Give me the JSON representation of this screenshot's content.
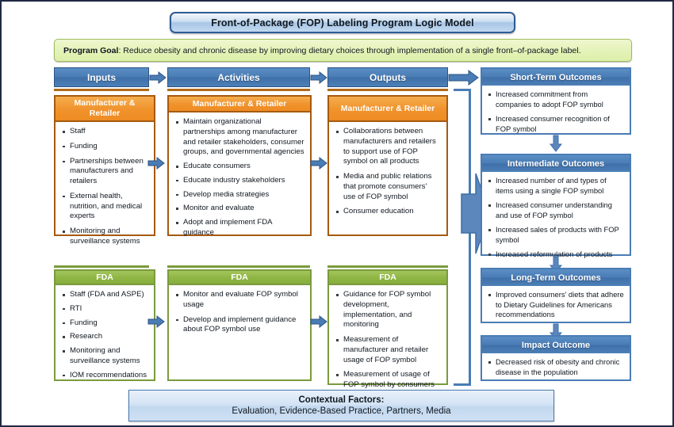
{
  "diagram": {
    "title": "Front-of-Package (FOP) Labeling Program Logic Model",
    "program_goal_label": "Program Goal",
    "program_goal_text": ": Reduce obesity and chronic disease by improving dietary choices through implementation of a single front–of-package label.",
    "colors": {
      "header_blue": "#4a7cb5",
      "orange": "#f0922c",
      "orange_border": "#a55a10",
      "green": "#8fb545",
      "green_border": "#7a9b3e",
      "goal_green": "#e3f2b6",
      "frame": "#1f2a44"
    }
  },
  "columns": {
    "inputs": "Inputs",
    "activities": "Activities",
    "outputs": "Outputs"
  },
  "manufacturer_retailer": {
    "inputs": {
      "heading": "Manufacturer & Retailer",
      "items": [
        "Staff",
        "Funding",
        "Partnerships between manufacturers and retailers",
        "External health, nutrition, and medical experts",
        "Monitoring and surveillance systems"
      ]
    },
    "activities": {
      "heading": "Manufacturer & Retailer",
      "items": [
        "Maintain organizational partnerships among manufacturer and retailer stakeholders, consumer groups, and governmental agencies",
        "Educate consumers",
        "Educate industry stakeholders",
        "Develop media strategies",
        "Monitor and evaluate",
        "Adopt and implement FDA guidance"
      ]
    },
    "outputs": {
      "heading": "Manufacturer & Retailer",
      "items": [
        "Collaborations between manufacturers and retailers to support use of FOP symbol on all products",
        "Media and public relations that promote consumers' use of FOP symbol",
        "Consumer education"
      ]
    }
  },
  "fda": {
    "inputs": {
      "heading": "FDA",
      "items": [
        "Staff (FDA and ASPE)",
        "RTI",
        "Funding",
        "Research",
        "Monitoring and surveillance systems",
        "IOM recommendations"
      ]
    },
    "activities": {
      "heading": "FDA",
      "items": [
        "Monitor and evaluate FOP symbol usage",
        "Develop and implement guidance about FOP symbol use"
      ]
    },
    "outputs": {
      "heading": "FDA",
      "items": [
        "Guidance for FOP symbol development, implementation, and monitoring",
        "Measurement of manufacturer and retailer usage of FOP symbol",
        "Measurement of usage of FOP symbol by consumers"
      ]
    }
  },
  "outcomes": {
    "short_term": {
      "heading": "Short-Term Outcomes",
      "items": [
        "Increased commitment from companies to adopt FOP symbol",
        "Increased consumer recognition of FOP symbol"
      ]
    },
    "intermediate": {
      "heading": "Intermediate Outcomes",
      "items": [
        "Increased number of and types of items using a single FOP symbol",
        "Increased consumer understanding and use of FOP symbol",
        "Increased sales of products with FOP symbol",
        "Increased reformulation of products"
      ]
    },
    "long_term": {
      "heading": "Long-Term Outcomes",
      "items": [
        "Improved consumers' diets that adhere to Dietary Guidelines for Americans recommendations"
      ]
    },
    "impact": {
      "heading": "Impact Outcome",
      "items": [
        "Decreased risk of obesity and chronic disease in the population"
      ]
    }
  },
  "contextual_factors": {
    "line1": "Contextual Factors:",
    "line2": "Evaluation, Evidence-Based Practice, Partners, Media"
  }
}
